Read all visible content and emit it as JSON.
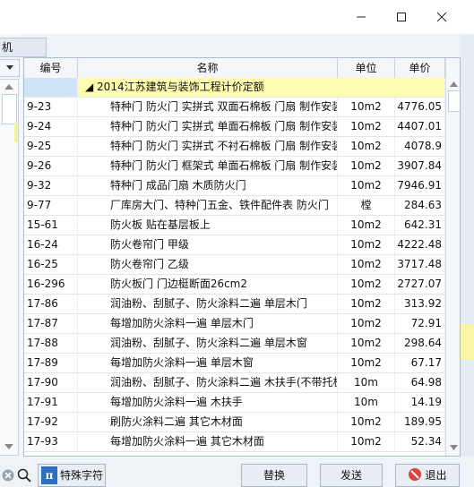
{
  "window": {
    "minimize": "—",
    "maximize": "☐",
    "close": "✕"
  },
  "left_tab": "机",
  "table": {
    "headers": {
      "code": "编号",
      "name": "名称",
      "unit": "单位",
      "price": "单价"
    },
    "group_label": "◢ 2014江苏建筑与装饰工程计价定额",
    "rows": [
      {
        "code": "9-23",
        "name": "特种门 防火门 实拼式 双面石棉板 门扇 制作安装",
        "unit": "10m2",
        "price": "4776.05"
      },
      {
        "code": "9-24",
        "name": "特种门 防火门 实拼式 单面石棉板 门扇 制作安装",
        "unit": "10m2",
        "price": "4407.01"
      },
      {
        "code": "9-25",
        "name": "特种门 防火门 实拼式 不衬石棉板 门扇 制作安装",
        "unit": "10m2",
        "price": "4078.9"
      },
      {
        "code": "9-26",
        "name": "特种门 防火门 框架式 单面石棉板 门扇 制作安装",
        "unit": "10m2",
        "price": "3907.84"
      },
      {
        "code": "9-32",
        "name": "特种门 成品门扇 木质防火门",
        "unit": "10m2",
        "price": "7946.91"
      },
      {
        "code": "9-77",
        "name": "厂库房大门、特种门五金、铁件配件表 防火门",
        "unit": "樘",
        "price": "284.63"
      },
      {
        "code": "15-61",
        "name": "防火板 贴在基层板上",
        "unit": "10m2",
        "price": "642.31"
      },
      {
        "code": "16-24",
        "name": "防火卷帘门 甲级",
        "unit": "10m2",
        "price": "4222.48"
      },
      {
        "code": "16-25",
        "name": "防火卷帘门 乙级",
        "unit": "10m2",
        "price": "3717.48"
      },
      {
        "code": "16-296",
        "name": "防火板门 门边梃断面26cm2",
        "unit": "10m2",
        "price": "2727.07"
      },
      {
        "code": "17-86",
        "name": "润油粉、刮腻子、防火涂料二遍 单层木门",
        "unit": "10m2",
        "price": "313.92"
      },
      {
        "code": "17-87",
        "name": "每增加防火涂料一遍 单层木门",
        "unit": "10m2",
        "price": "72.91"
      },
      {
        "code": "17-88",
        "name": "润油粉、刮腻子、防火涂料二遍 单层木窗",
        "unit": "10m2",
        "price": "298.64"
      },
      {
        "code": "17-89",
        "name": "每增加防火涂料一遍 单层木窗",
        "unit": "10m2",
        "price": "67.17"
      },
      {
        "code": "17-90",
        "name": "润油粉、刮腻子、防火涂料二遍 木扶手(不带托板)",
        "unit": "10m",
        "price": "64.98"
      },
      {
        "code": "17-91",
        "name": "每增加防火涂料一遍 木扶手",
        "unit": "10m",
        "price": "14.19"
      },
      {
        "code": "17-92",
        "name": "刷防火涂料二遍 其它木材面",
        "unit": "10m2",
        "price": "189.95"
      },
      {
        "code": "17-93",
        "name": "每增加防火涂料一遍 其它木材面",
        "unit": "10m2",
        "price": "52.34"
      }
    ]
  },
  "toolbar": {
    "special_chars_icon": "π",
    "special_chars": "特殊字符",
    "replace": "替换",
    "send": "发送",
    "exit": "退出"
  },
  "colors": {
    "group_row": "#fdfdb0",
    "exit_icon": "#e0423a"
  }
}
